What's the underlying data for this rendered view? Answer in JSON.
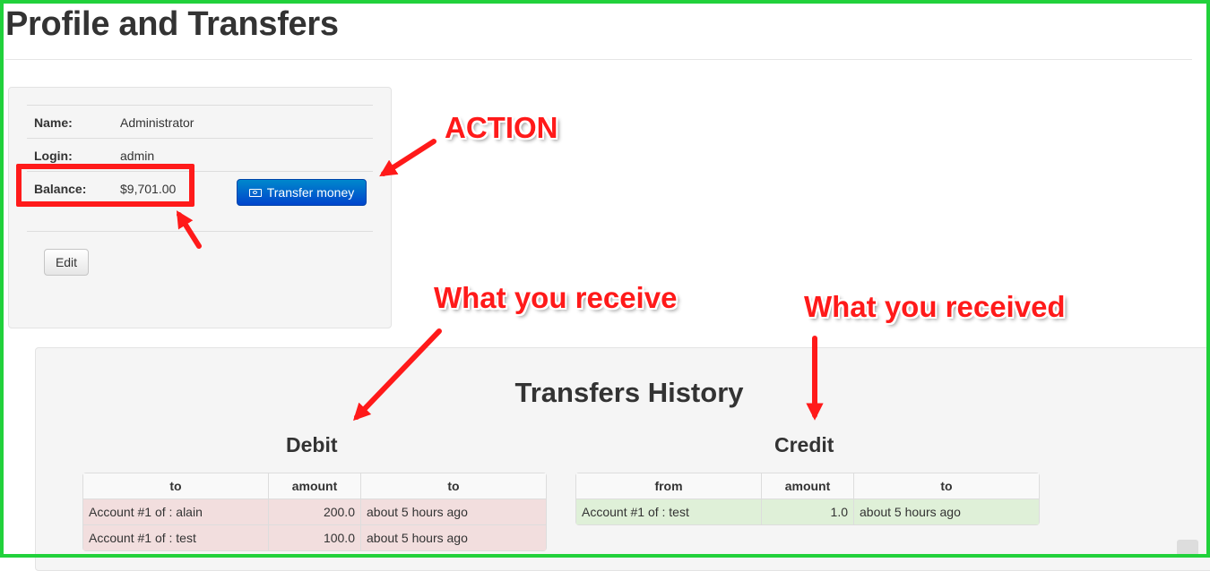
{
  "page": {
    "title": "Profile and Transfers"
  },
  "profile": {
    "rows": [
      {
        "label": "Name:",
        "value": "Administrator"
      },
      {
        "label": "Login:",
        "value": "admin"
      },
      {
        "label": "Balance:",
        "value": "$9,701.00"
      }
    ],
    "transfer_button": {
      "label": "Transfer money",
      "icon": "cash-icon"
    },
    "edit_button": "Edit"
  },
  "history": {
    "title": "Transfers History",
    "debit": {
      "title": "Debit",
      "columns": [
        "to",
        "amount",
        "to"
      ],
      "rows": [
        [
          "Account #1 of : alain",
          "200.0",
          "about 5 hours ago"
        ],
        [
          "Account #1 of : test",
          "100.0",
          "about 5 hours ago"
        ]
      ],
      "row_color": "#f2dede"
    },
    "credit": {
      "title": "Credit",
      "columns": [
        "from",
        "amount",
        "to"
      ],
      "rows": [
        [
          "Account #1 of : test",
          "1.0",
          "about 5 hours ago"
        ]
      ],
      "row_color": "#dff0d8"
    }
  },
  "annotations": {
    "action": "ACTION",
    "receive": "What you receive",
    "received": "What you received",
    "color": "#ff1a1a"
  },
  "colors": {
    "frame": "#21d13b",
    "primary_button": "#0055cc"
  }
}
